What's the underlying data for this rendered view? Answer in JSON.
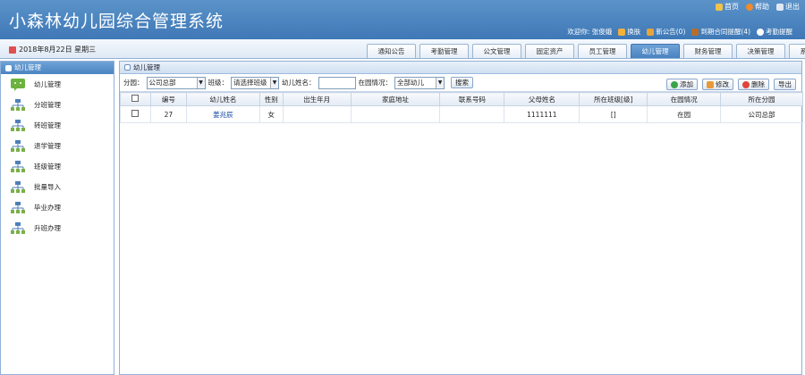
{
  "app": {
    "title": "小森林幼儿园综合管理系统"
  },
  "top_links": [
    {
      "label": "首页",
      "icon": "home-icon"
    },
    {
      "label": "帮助",
      "icon": "help-icon"
    },
    {
      "label": "退出",
      "icon": "exit-icon"
    }
  ],
  "user_bar": {
    "welcome": "欢迎你: 张俊娥",
    "switch": "换肤",
    "notice": "新公告(0)",
    "contract": "到期合同提醒(4)",
    "attendance": "考勤提醒"
  },
  "date": "2018年8月22日 星期三",
  "tabs": [
    "通知公告",
    "考勤管理",
    "公文管理",
    "固定资产",
    "员工管理",
    "幼儿管理",
    "财务管理",
    "决策管理",
    "系统管理"
  ],
  "active_tab": "幼儿管理",
  "sidebar": {
    "title": "幼儿管理",
    "items": [
      "幼儿管理",
      "分班管理",
      "转班管理",
      "退学管理",
      "班级管理",
      "批量导入",
      "毕业办理",
      "升班办理"
    ]
  },
  "main": {
    "title": "幼儿管理"
  },
  "filters": {
    "branch_label": "分园：",
    "branch_value": "公司总部",
    "class_label": "班级：",
    "class_value": "请选择班级",
    "name_label": "幼儿姓名：",
    "name_value": "",
    "status_label": "在园情况：",
    "status_value": "全部幼儿",
    "search": "搜索"
  },
  "actions": {
    "add": "添加",
    "edit": "修改",
    "delete": "删除",
    "export": "导出"
  },
  "table": {
    "headers": [
      "",
      "编号",
      "幼儿姓名",
      "性别",
      "出生年月",
      "家庭地址",
      "联系号码",
      "父母姓名",
      "所在班级[级]",
      "在园情况",
      "所在分园"
    ],
    "rows": [
      [
        "",
        "27",
        "姜兆辰",
        "女",
        "",
        "",
        "",
        "1111111",
        "[]",
        "在园",
        "公司总部"
      ]
    ]
  },
  "colors": {
    "header": "#4a83c0",
    "accent": "#5b93c9"
  }
}
